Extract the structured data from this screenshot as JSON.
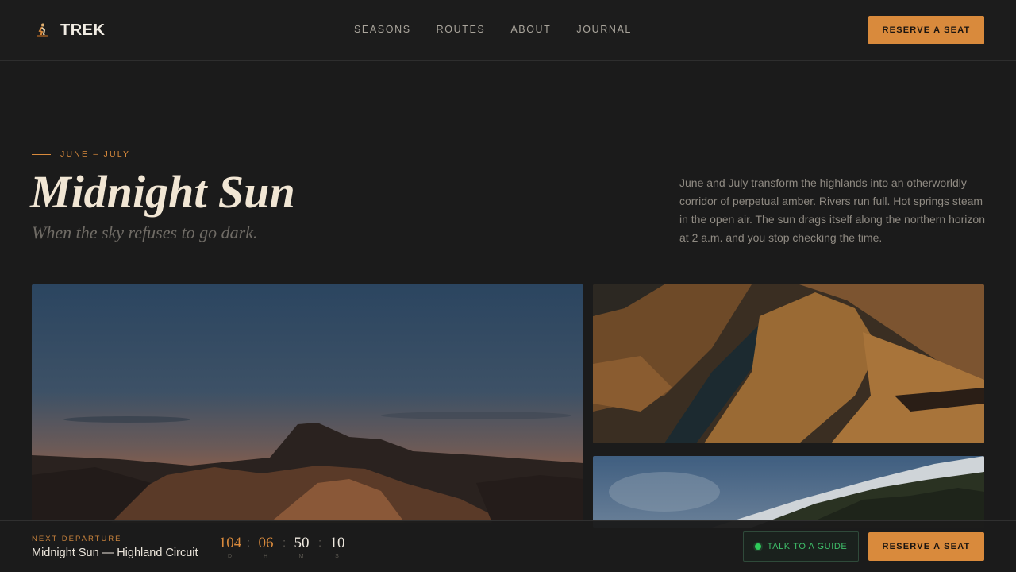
{
  "brand": {
    "name": "TREK",
    "icon": "hiker-icon"
  },
  "nav": {
    "items": [
      "SEASONS",
      "ROUTES",
      "ABOUT",
      "JOURNAL"
    ]
  },
  "header": {
    "cta_label": "RESERVE A SEAT"
  },
  "hero": {
    "eyebrow": "JUNE – JULY",
    "title": "Midnight Sun",
    "subtitle": "When the sky refuses to go dark.",
    "description": "June and July transform the highlands into an otherworldly corridor of perpetual amber. Rivers run full. Hot springs steam in the open air. The sun drags itself along the northern horizon at 2 a.m. and you stop checking the time."
  },
  "bottom_bar": {
    "label": "NEXT DEPARTURE",
    "trip_name": "Midnight Sun — Highland Circuit",
    "countdown": {
      "days": "104",
      "hours": "06",
      "minutes": "50",
      "seconds": "10",
      "unit_days": "D",
      "unit_hours": "H",
      "unit_minutes": "M",
      "unit_seconds": "S",
      "separator": ":"
    },
    "guide_label": "TALK TO A GUIDE",
    "cta_label": "RESERVE A SEAT"
  },
  "colors": {
    "accent": "#d98a3c",
    "background": "#1b1b1b",
    "online": "#2ecc5a"
  }
}
